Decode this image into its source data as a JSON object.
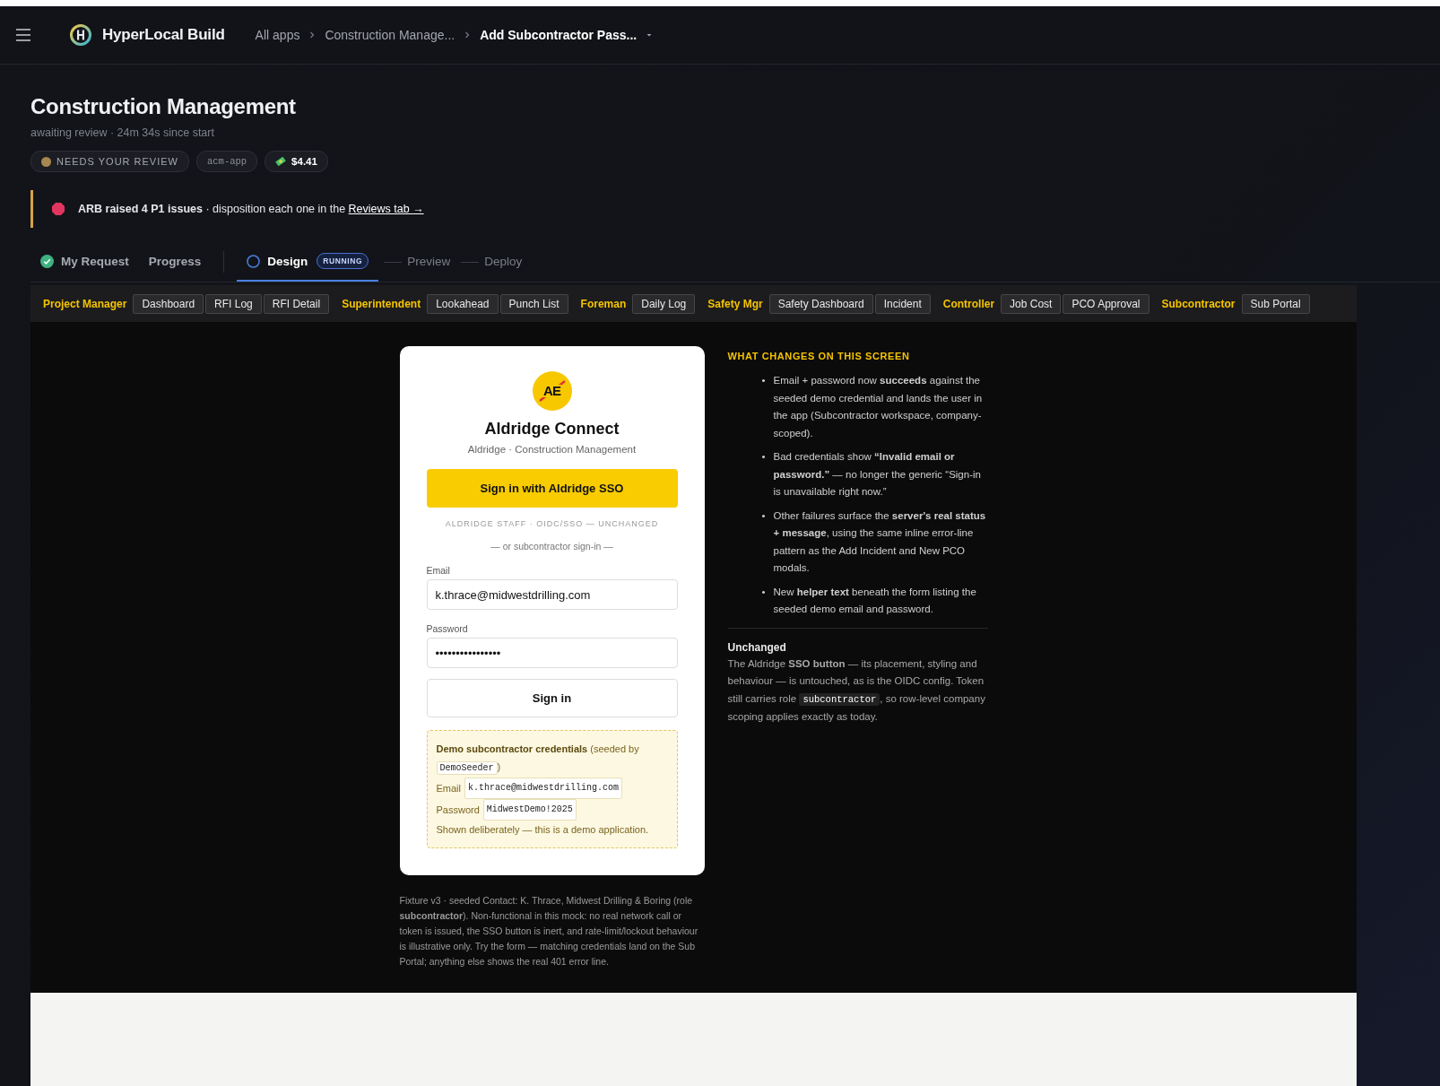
{
  "header": {
    "brand": "HyperLocal Build",
    "breadcrumbs": [
      {
        "label": "All apps",
        "kind": "link"
      },
      {
        "label": "Construction Manage...",
        "kind": "link"
      },
      {
        "label": "Add Subcontractor Pass...",
        "kind": "current"
      }
    ]
  },
  "project": {
    "title": "Construction Management",
    "subtitle": "awaiting review · 24m 34s since start",
    "badges": [
      {
        "kind": "status",
        "label": "NEEDS YOUR REVIEW"
      },
      {
        "kind": "code",
        "label": "acm-app"
      },
      {
        "kind": "cost",
        "label": "$4.41"
      }
    ]
  },
  "alert": {
    "text": "**ARB raised 4 P1 issues** · disposition each one in the",
    "link": "Reviews tab →"
  },
  "steps": [
    {
      "label": "My Request",
      "kind": "done",
      "selected": false
    },
    {
      "label": "Progress",
      "kind": "plain",
      "selected": false
    },
    {
      "label": "Design",
      "kind": "running",
      "selected": true,
      "badge": "RUNNING"
    },
    {
      "label": "Preview",
      "kind": "pending",
      "selected": false
    },
    {
      "label": "Deploy",
      "kind": "pending",
      "selected": false
    }
  ],
  "role_nav": [
    {
      "role": "Project Manager",
      "screens": [
        "Dashboard",
        "RFI Log",
        "RFI Detail"
      ]
    },
    {
      "role": "Superintendent",
      "screens": [
        "Lookahead",
        "Punch List"
      ]
    },
    {
      "role": "Foreman",
      "screens": [
        "Daily Log"
      ]
    },
    {
      "role": "Safety Mgr",
      "screens": [
        "Safety Dashboard",
        "Incident"
      ]
    },
    {
      "role": "Controller",
      "screens": [
        "Job Cost",
        "PCO Approval"
      ]
    },
    {
      "role": "Subcontractor",
      "screens": [
        "Sub Portal"
      ]
    }
  ],
  "login": {
    "logo_text": "AE",
    "app_name": "Aldridge Connect",
    "org_line": "Aldridge · Construction Management",
    "sso_button": "Sign in with Aldridge SSO",
    "sso_note": "ALDRIDGE STAFF · OIDC/SSO — UNCHANGED",
    "divider": "— or subcontractor sign-in —",
    "email": {
      "label": "Email",
      "value": "k.thrace@midwestdrilling.com"
    },
    "password": {
      "label": "Password",
      "value": "••••••••••••••••"
    },
    "sign_in_button": "Sign in",
    "helper": {
      "intro": "**Demo subcontractor credentials** (seeded by",
      "intro_code": "DemoSeeder",
      "intro_after": ")",
      "rows": [
        {
          "label": "Email",
          "value": "k.thrace@midwestdrilling.com"
        },
        {
          "label": "Password",
          "value": "MidwestDemo!2025"
        }
      ],
      "note": "Shown deliberately — this is a demo application."
    }
  },
  "footnote": "Fixture v3 · seeded Contact: K. Thrace, Midwest Drilling & Boring (role **subcontractor**). Non-functional in this mock: no real network call or token is issued, the SSO button is inert, and rate-limit/lockout behaviour is illustrative only. Try the form — matching credentials land on the Sub Portal; anything else shows the real 401 error line.",
  "changes": {
    "heading": "WHAT CHANGES ON THIS SCREEN",
    "marker": "•",
    "bullets": [
      "Email + password now **succeeds** against the seeded demo credential and lands the user in the app (Subcontractor workspace, company-scoped).",
      "Bad credentials show **“Invalid email or password.”** — no longer the generic “Sign-in is unavailable right now.”",
      "Other failures surface the **server's real status + message**, using the same inline error-line pattern as the Add Incident and New PCO modals.",
      "New **helper text** beneath the form listing the seeded demo email and password."
    ],
    "unchanged_heading": "Unchanged",
    "unchanged_text": "The Aldridge **SSO button** — its placement, styling and behaviour — is untouched, as is the OIDC config. Token still carries role",
    "unchanged_code": "subcontractor",
    "unchanged_after": ", so row-level company scoping applies exactly as today."
  }
}
